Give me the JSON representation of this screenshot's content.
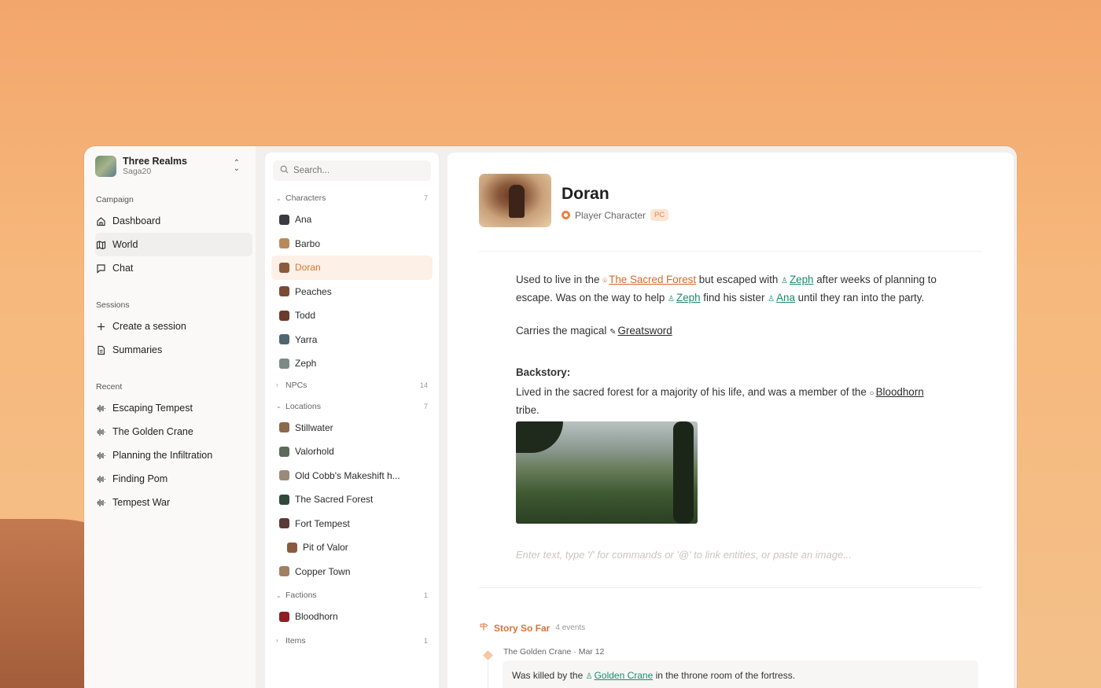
{
  "workspace": {
    "name": "Three Realms",
    "system": "Saga20"
  },
  "sidebar": {
    "campaign_title": "Campaign",
    "campaign_items": [
      {
        "label": "Dashboard",
        "icon": "home-icon"
      },
      {
        "label": "World",
        "icon": "map-icon"
      },
      {
        "label": "Chat",
        "icon": "chat-icon"
      }
    ],
    "sessions_title": "Sessions",
    "session_items": [
      {
        "label": "Create a session",
        "icon": "plus-icon"
      },
      {
        "label": "Summaries",
        "icon": "document-icon"
      }
    ],
    "recent_title": "Recent",
    "recent_items": [
      {
        "label": "Escaping Tempest",
        "icon": "waveform-icon"
      },
      {
        "label": "The Golden Crane",
        "icon": "waveform-icon"
      },
      {
        "label": "Planning the Infiltration",
        "icon": "waveform-icon"
      },
      {
        "label": "Finding Pom",
        "icon": "waveform-icon"
      },
      {
        "label": "Tempest War",
        "icon": "waveform-icon"
      }
    ]
  },
  "list": {
    "search_placeholder": "Search...",
    "groups": {
      "characters": {
        "label": "Characters",
        "count": "7",
        "items": [
          "Ana",
          "Barbo",
          "Doran",
          "Peaches",
          "Todd",
          "Yarra",
          "Zeph"
        ]
      },
      "npcs": {
        "label": "NPCs",
        "count": "14"
      },
      "locations": {
        "label": "Locations",
        "count": "7",
        "items": [
          "Stillwater",
          "Valorhold",
          "Old Cobb's Makeshift h...",
          "The Sacred Forest",
          "Fort Tempest",
          "Pit of Valor",
          "Copper Town"
        ]
      },
      "factions": {
        "label": "Factions",
        "count": "1",
        "items": [
          "Bloodhorn"
        ]
      },
      "items": {
        "label": "Items",
        "count": "1"
      }
    }
  },
  "entity": {
    "name": "Doran",
    "type": "Player Character",
    "badge": "PC",
    "p1": {
      "t1": "Used to live in the ",
      "link1": "The Sacred Forest",
      "t2": " but escaped with ",
      "link2": "Zeph",
      "t3": " after weeks of planning to escape. Was on the way to help ",
      "link3": "Zeph",
      "t4": " find his sister ",
      "link4": "Ana",
      "t5": " until they ran into the party."
    },
    "p2": {
      "t1": "Carries the magical ",
      "link1": "Greatsword"
    },
    "backstory_heading": "Backstory:",
    "p3": {
      "t1": "Lived in the sacred forest for a majority of his life, and was a member of the ",
      "link1": "Bloodhorn",
      "t2": " tribe."
    },
    "editor_placeholder": "Enter text, type '/' for commands or '@' to link entities, or paste an image...",
    "story": {
      "title": "Story So Far",
      "count": "4 events",
      "event_meta": "The Golden Crane · Mar 12",
      "event_t1": "Was killed by the ",
      "event_link": "Golden Crane",
      "event_t2": " in the throne room of the fortress."
    }
  },
  "colors": {
    "accent": "#d9733a",
    "link_green": "#1e8a6e",
    "selected_bg": "#fdf0e6"
  }
}
